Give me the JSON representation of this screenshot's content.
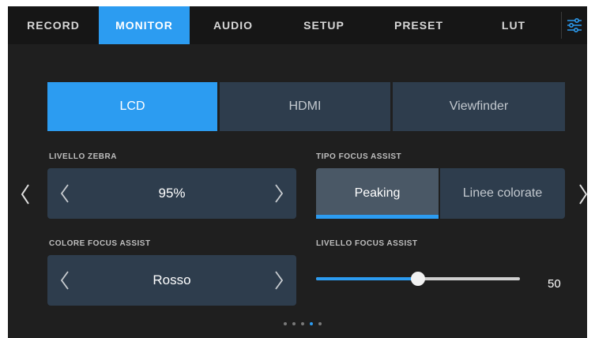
{
  "tabs": [
    {
      "label": "RECORD",
      "active": false
    },
    {
      "label": "MONITOR",
      "active": true
    },
    {
      "label": "AUDIO",
      "active": false
    },
    {
      "label": "SETUP",
      "active": false
    },
    {
      "label": "PRESET",
      "active": false
    },
    {
      "label": "LUT",
      "active": false
    }
  ],
  "settings_icon": "sliders-icon",
  "outputs": [
    {
      "label": "LCD",
      "active": true
    },
    {
      "label": "HDMI",
      "active": false
    },
    {
      "label": "Viewfinder",
      "active": false
    }
  ],
  "zebra": {
    "label": "LIVELLO ZEBRA",
    "value": "95%"
  },
  "focus_type": {
    "label": "TIPO FOCUS ASSIST",
    "options": [
      {
        "label": "Peaking",
        "active": true
      },
      {
        "label": "Linee colorate",
        "active": false
      }
    ]
  },
  "focus_color": {
    "label": "COLORE FOCUS ASSIST",
    "value": "Rosso"
  },
  "focus_level": {
    "label": "LIVELLO FOCUS ASSIST",
    "value": "50",
    "fraction": 0.5
  },
  "pagination": {
    "count": 5,
    "active_index": 3
  },
  "colors": {
    "accent": "#2c9cf1",
    "panel": "#2e3d4d",
    "background": "#1f1f1f"
  }
}
